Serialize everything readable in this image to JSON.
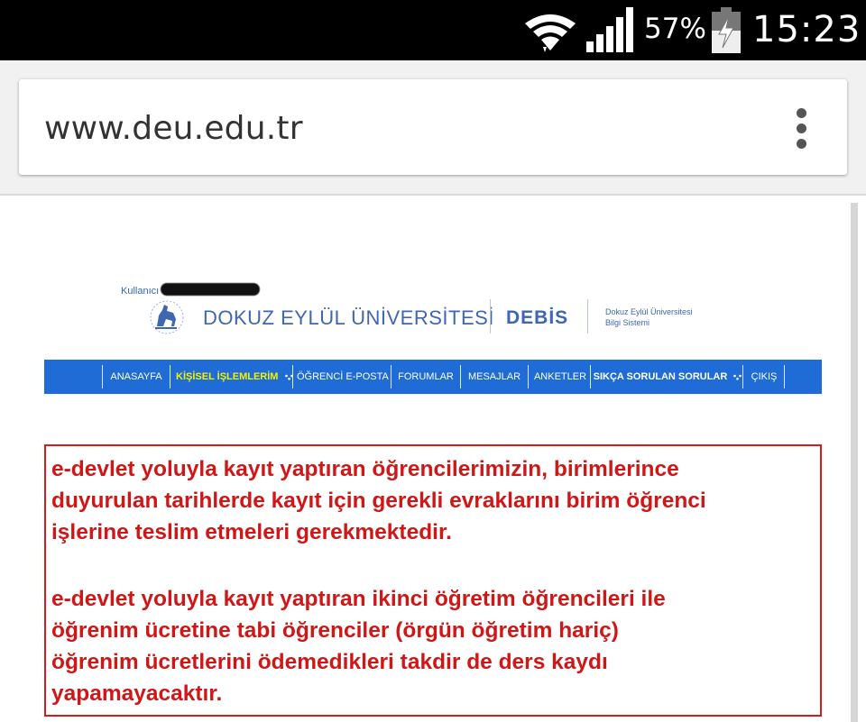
{
  "status_bar": {
    "battery_percent": "57%",
    "time": "15:23",
    "icons": [
      "wifi-icon",
      "signal-icon",
      "battery-charging-icon"
    ]
  },
  "browser": {
    "url": "www.deu.edu.tr",
    "menu_icon": "overflow-menu-icon"
  },
  "header": {
    "user_label": "Kullanıcı",
    "university_name": "DOKUZ EYLÜL ÜNİVERSİTESİ",
    "system_short": "DEBİS",
    "system_full_line1": "Dokuz Eylül Üniversitesi",
    "system_full_line2": "Bilgi Sistemi"
  },
  "nav": {
    "items": [
      {
        "label": "ANASAYFA"
      },
      {
        "label": "KİŞİSEL İŞLEMLERİM"
      },
      {
        "label": "ÖĞRENCİ E-POSTA"
      },
      {
        "label": "FORUMLAR"
      },
      {
        "label": "MESAJLAR"
      },
      {
        "label": "ANKETLER"
      },
      {
        "label": "SIKÇA SORULAN SORULAR"
      },
      {
        "label": "ÇIKIŞ"
      }
    ]
  },
  "notice": {
    "paragraph1": "e-devlet yoluyla kayıt yaptıran öğrencilerimizin, birimlerince\nduyurulan tarihlerde kayıt için gerekli evraklarını birim öğrenci\nişlerine teslim etmeleri gerekmektedir.",
    "paragraph2": "e-devlet yoluyla kayıt yaptıran ikinci öğretim öğrencileri ile\nöğrenim ücretine tabi öğrenciler (örgün öğretim hariç)\nöğrenim ücretlerini ödemedikleri takdir de ders kaydı\nyapamayacaktır."
  },
  "colors": {
    "nav_bg": "#1f6cd6",
    "brand_blue": "#3f67b1",
    "notice_red": "#d01717",
    "active_nav": "#f2f200"
  }
}
